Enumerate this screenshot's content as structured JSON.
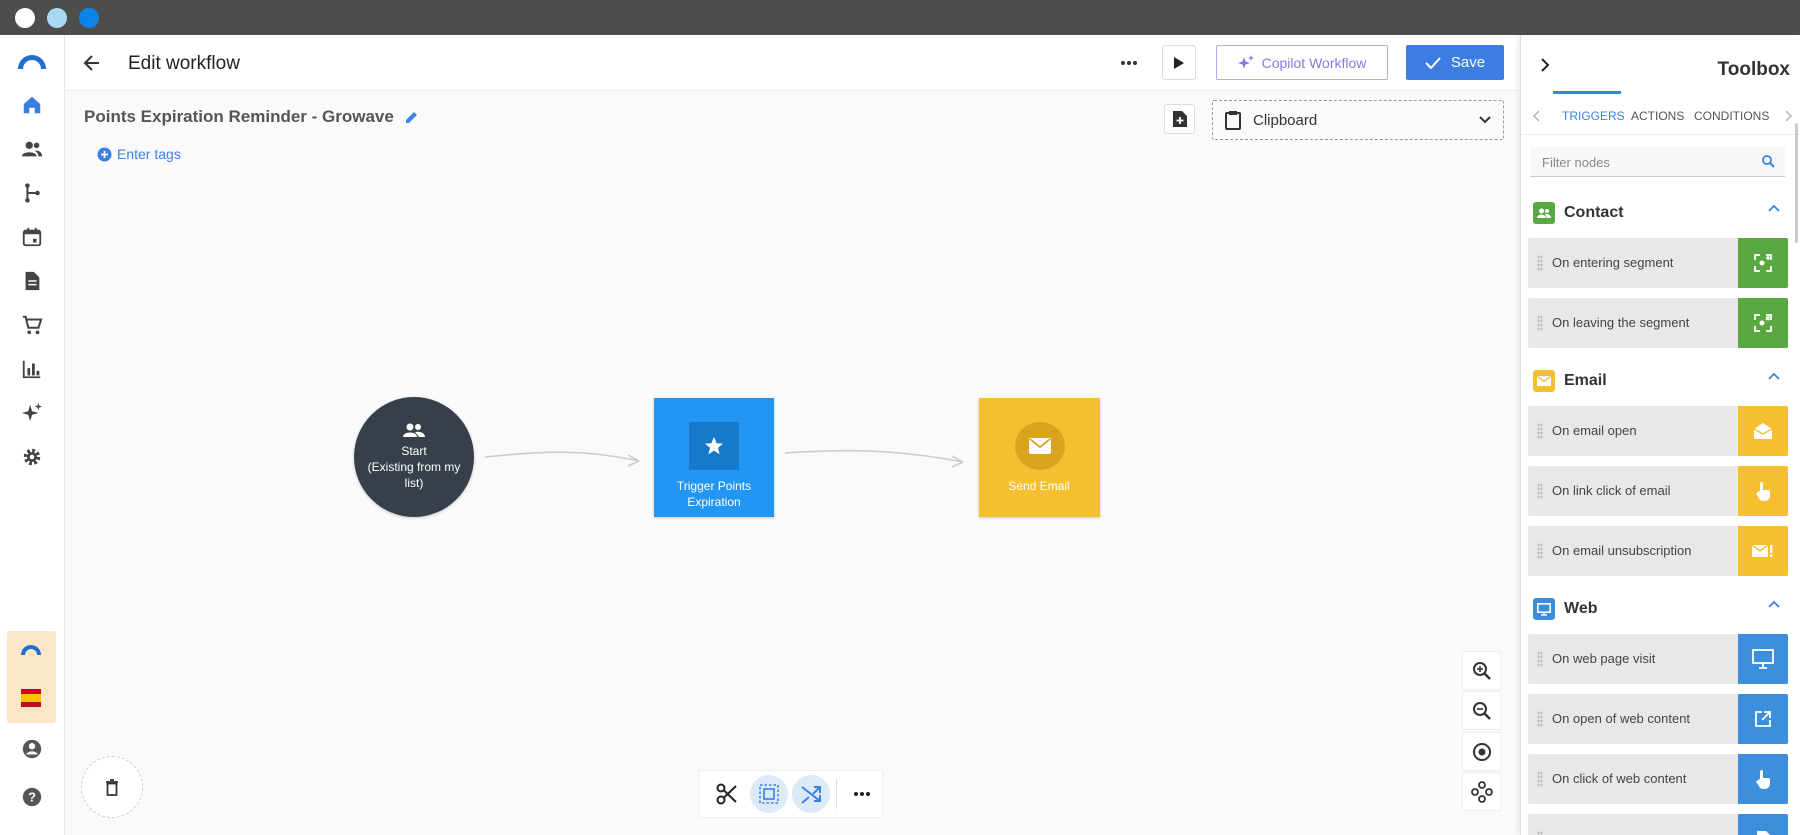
{
  "colors": {
    "titlebar": "#4d4d4d",
    "accent": "#3b7de0",
    "copilot": "#8a74e8",
    "start_node": "#37404a",
    "trigger_node": "#2196f3",
    "email_node": "#f5c030",
    "contact_green": "#5aa843",
    "email_yellow": "#f5c030",
    "web_blue": "#3b8fdc"
  },
  "window": {
    "dots": [
      "#ffffff",
      "#a8d8f4",
      "#0a84e8"
    ]
  },
  "sidebar": {
    "items": [
      {
        "icon": "logo-icon"
      },
      {
        "icon": "home-icon"
      },
      {
        "icon": "people-icon"
      },
      {
        "icon": "workflow-icon"
      },
      {
        "icon": "calendar-icon"
      },
      {
        "icon": "document-icon"
      },
      {
        "icon": "cart-icon"
      },
      {
        "icon": "chart-icon"
      },
      {
        "icon": "sparkle-icon"
      },
      {
        "icon": "gear-icon"
      },
      {
        "icon": "account-icon"
      },
      {
        "icon": "help-icon"
      }
    ]
  },
  "header": {
    "title": "Edit workflow",
    "copilot_label": "Copilot Workflow",
    "save_label": "Save"
  },
  "canvas": {
    "workflow_name": "Points Expiration Reminder - Growave",
    "tags_label": "Enter tags",
    "clipboard_label": "Clipboard",
    "nodes": {
      "start": {
        "title": "Start",
        "subtitle": "(Existing from my list)"
      },
      "trigger": {
        "label": "Trigger Points Expiration"
      },
      "email": {
        "label": "Send Email"
      }
    }
  },
  "toolbox": {
    "title": "Toolbox",
    "tabs": [
      "TRIGGERS",
      "ACTIONS",
      "CONDITIONS"
    ],
    "active_tab": "TRIGGERS",
    "filter_placeholder": "Filter nodes",
    "sections": {
      "contact": {
        "label": "Contact",
        "items": [
          "On entering segment",
          "On leaving the segment"
        ]
      },
      "email": {
        "label": "Email",
        "items": [
          "On email open",
          "On link click of email",
          "On email unsubscription"
        ]
      },
      "web": {
        "label": "Web",
        "items": [
          "On web page visit",
          "On open of web content",
          "On click of web content"
        ]
      }
    }
  }
}
